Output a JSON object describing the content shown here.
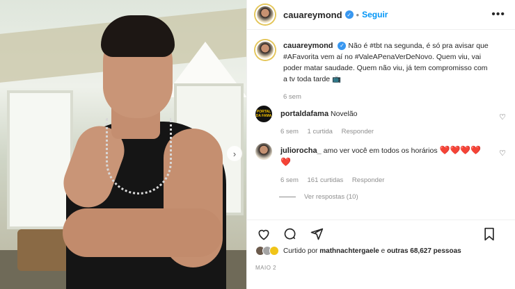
{
  "header": {
    "username": "cauareymond",
    "separator": "•",
    "follow_label": "Seguir",
    "more_icon": "more-horizontal-icon"
  },
  "caption": {
    "username": "cauareymond",
    "text": "Não é #tbt na segunda, é só pra avisar que #AFavorita vem aí no #ValeAPenaVerDeNovo. Quem viu, vai poder matar saudade. Quem não viu, já tem compromisso com a tv toda tarde 📺",
    "time": "6 sem"
  },
  "comments": [
    {
      "username": "portaldafama",
      "text": "Novelão",
      "time": "6 sem",
      "likes": "1 curtida",
      "reply_label": "Responder",
      "avatar_text": "PORTAL DA FAMA"
    },
    {
      "username": "juliorocha_",
      "text": "amo ver você em todos os horários",
      "hearts": "❤️❤️❤️❤️❤️",
      "time": "6 sem",
      "likes": "161 curtidas",
      "reply_label": "Responder",
      "view_replies": "Ver respostas (10)"
    }
  ],
  "actions": {
    "like_icon": "heart-icon",
    "comment_icon": "comment-icon",
    "share_icon": "share-icon",
    "save_icon": "bookmark-icon"
  },
  "likes": {
    "prefix": "Curtido por",
    "user": "mathnachtergaele",
    "suffix": "e",
    "others": "outras 68,627 pessoas"
  },
  "date": "MAIO 2",
  "colors": {
    "accent": "#0095f6",
    "verified": "#3897f0",
    "heart_red": "#ed4956",
    "muted": "#8e8e8e"
  }
}
